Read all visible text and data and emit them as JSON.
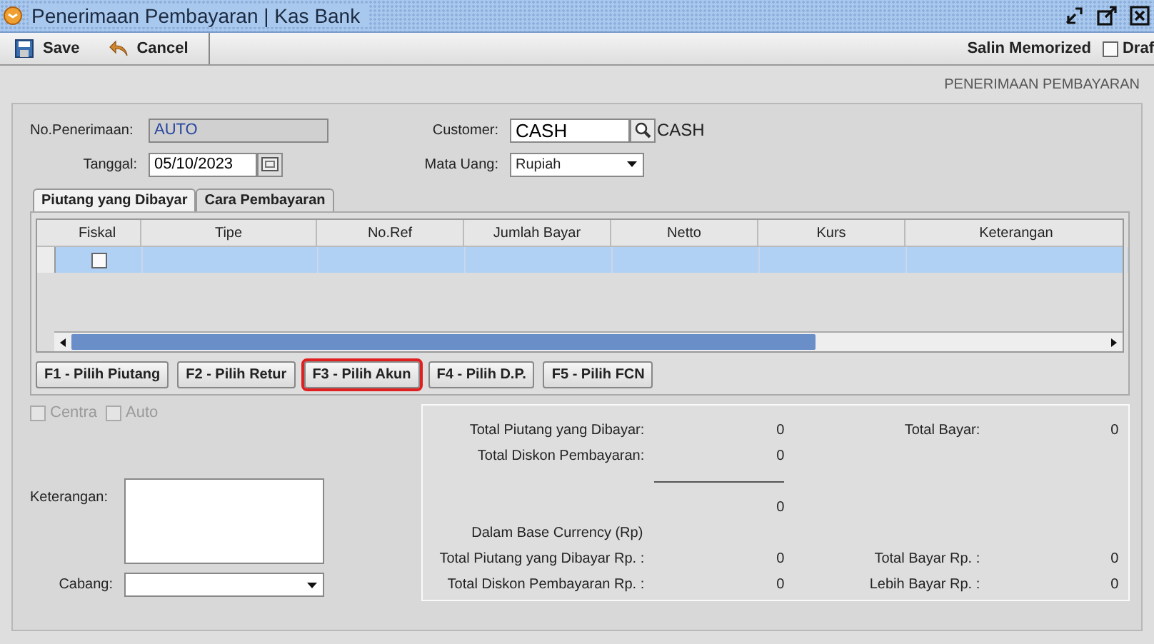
{
  "window": {
    "title": "Penerimaan Pembayaran | Kas Bank"
  },
  "toolbar": {
    "buttons": [
      {
        "label": "Save",
        "kind": "save"
      },
      {
        "label": "Cancel",
        "kind": "cancel"
      }
    ],
    "memorized_label": "Salin Memorized",
    "draft": {
      "label": "Draf",
      "checked": false
    }
  },
  "header": "PENERIMAAN PEMBAYARAN",
  "form": {
    "no_penerimaan": {
      "label": "No.Penerimaan:",
      "value": "AUTO"
    },
    "tanggal": {
      "label": "Tanggal:",
      "value": "05/10/2023"
    },
    "customer": {
      "label": "Customer:",
      "value": "CASH",
      "name": "CASH"
    },
    "mata_uang": {
      "label": "Mata Uang:",
      "value": "Rupiah"
    }
  },
  "tabs": [
    {
      "label": "Piutang yang Dibayar",
      "selected": true
    },
    {
      "label": "Cara Pembayaran",
      "selected": false
    }
  ],
  "table": {
    "columns": [
      "Fiskal",
      "Tipe",
      "No.Ref",
      "Jumlah Bayar",
      "Netto",
      "Kurs",
      "Keterangan"
    ],
    "rows": [
      {
        "fiskal": false,
        "selected": true
      }
    ]
  },
  "actions": [
    {
      "label": "F1 - Pilih Piutang",
      "highlighted": false
    },
    {
      "label": "F2 - Pilih Retur",
      "highlighted": false
    },
    {
      "label": "F3 - Pilih Akun",
      "highlighted": true
    },
    {
      "label": "F4 - Pilih D.P.",
      "highlighted": false
    },
    {
      "label": "F5 - Pilih FCN",
      "highlighted": false
    }
  ],
  "options": [
    {
      "label": "Centra",
      "checked": false,
      "disabled": true
    },
    {
      "label": "Auto",
      "checked": false,
      "disabled": true
    }
  ],
  "keterangan": {
    "label": "Keterangan:"
  },
  "cabang": {
    "label": "Cabang:"
  },
  "summary": [
    {
      "kind": "pair",
      "label": "Total Piutang yang Dibayar:",
      "value": "0",
      "right_label": "Total Bayar:",
      "right_value": "0"
    },
    {
      "kind": "pair",
      "label": "Total Diskon Pembayaran:",
      "value": "0"
    },
    {
      "kind": "rule"
    },
    {
      "kind": "pair",
      "value": "0"
    },
    {
      "kind": "heading",
      "label": "Dalam Base Currency (Rp)"
    },
    {
      "kind": "pair",
      "label": "Total Piutang yang Dibayar Rp. :",
      "value": "0",
      "right_label": "Total Bayar Rp. :",
      "right_value": "0"
    },
    {
      "kind": "pair",
      "label": "Total Diskon Pembayaran Rp. :",
      "value": "0",
      "right_label": "Lebih Bayar Rp. :",
      "right_value": "0"
    }
  ]
}
